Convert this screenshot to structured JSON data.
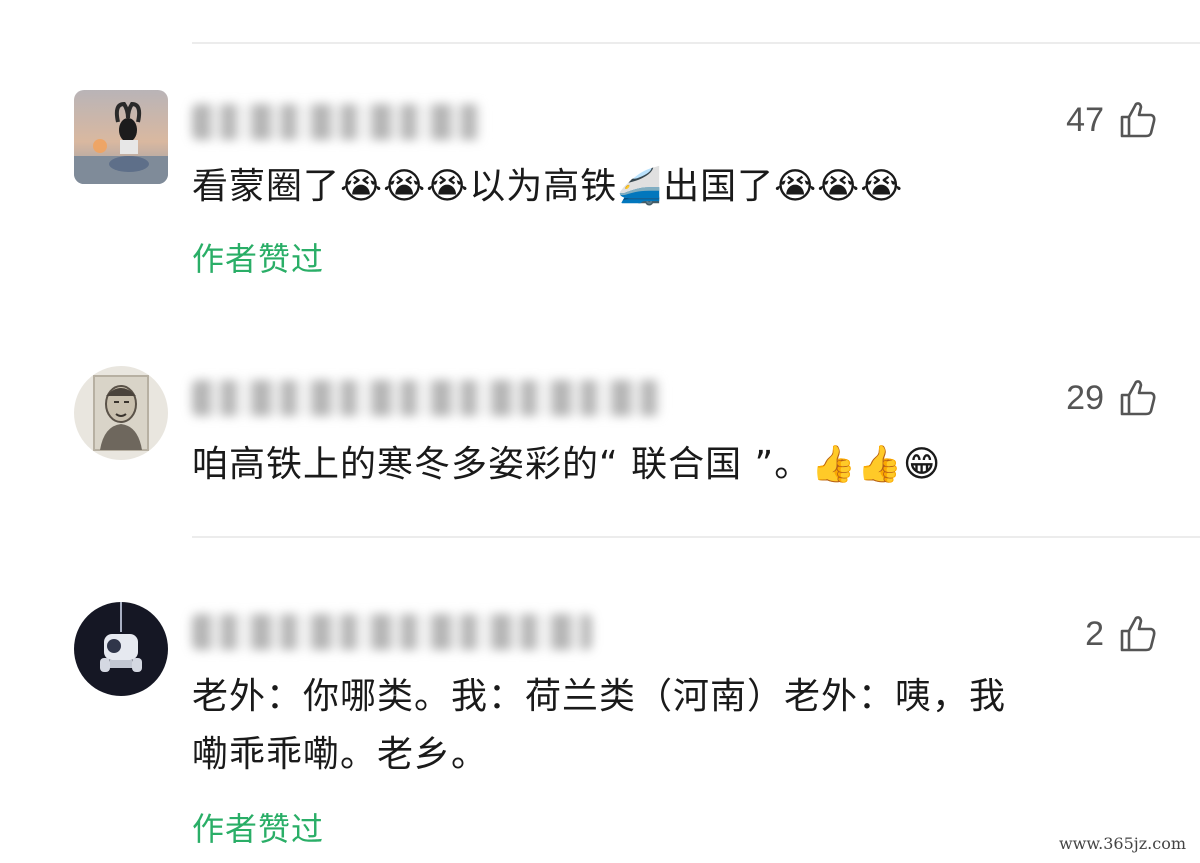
{
  "comments": [
    {
      "avatar": "girl-sunset-avatar",
      "likes": "47",
      "text_before": "看蒙圈了",
      "emoji_1": "😭😭😭",
      "text_middle": "以为高铁",
      "emoji_train": "🚄",
      "text_after": "出国了",
      "emoji_2": "😭😭😭",
      "author_liked": "作者赞过"
    },
    {
      "avatar": "portrait-avatar",
      "likes": "29",
      "text": "咱高铁上的寒冬多姿彩的“ 联合国 ”。",
      "emoji": "👍👍😁"
    },
    {
      "avatar": "astronaut-avatar",
      "likes": "2",
      "text_line_1": "老外：你哪类。我：荷兰类（河南）老外：咦，我",
      "text_line_2": "嘞乖乖嘞。老乡。",
      "author_liked": "作者赞过"
    }
  ],
  "watermark": "www.365jz.com",
  "icons": {
    "like": "thumbs-up-icon"
  },
  "colors": {
    "author_liked": "#2aae67",
    "likes": "#555555"
  }
}
